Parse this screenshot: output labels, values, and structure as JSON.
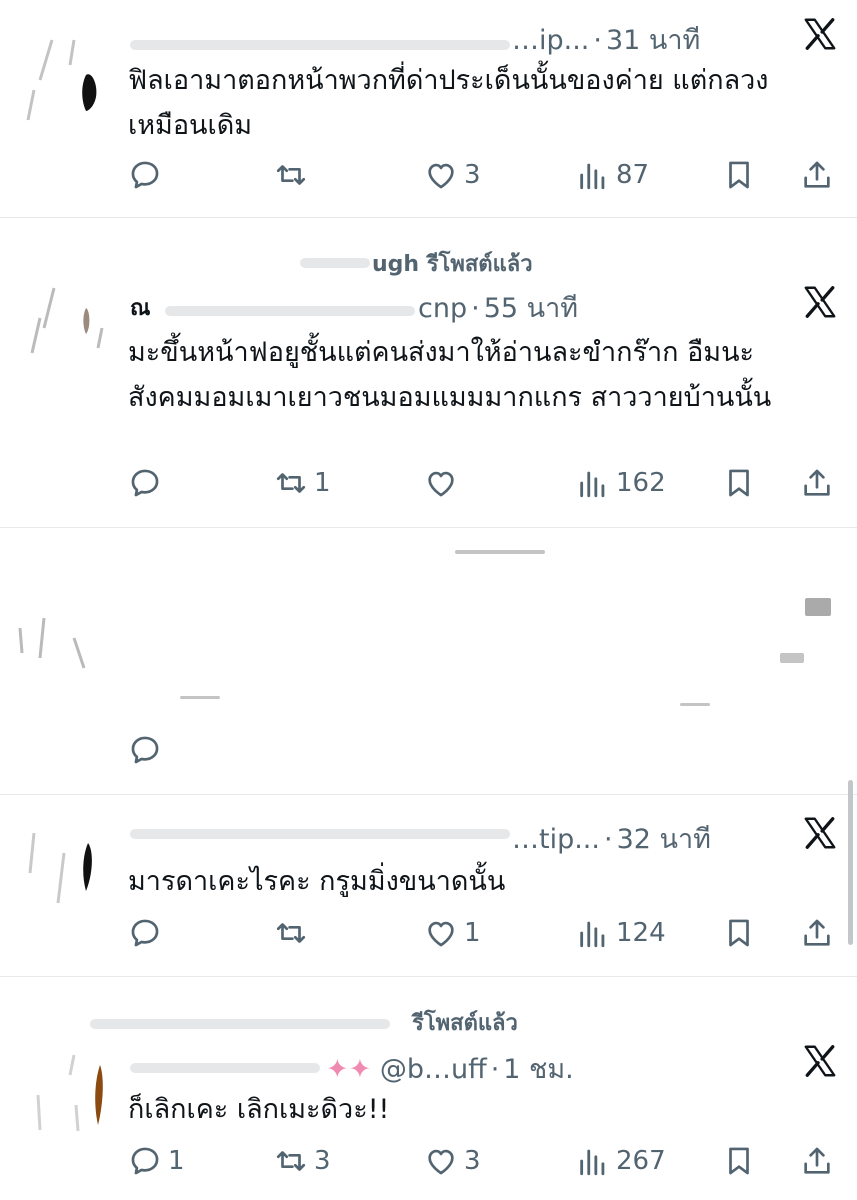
{
  "posts": [
    {
      "repost_label": "",
      "name_initial": "",
      "handle": "…ip...",
      "separator": "·",
      "time": "31 นาที",
      "text": "ฟิลเอามาตอกหน้าพวกที่ด่าประเด็นนั้นของค่าย แต่กลวงเหมือนเดิม",
      "counts": {
        "reply": "",
        "repost": "",
        "like": "3",
        "views": "87"
      }
    },
    {
      "repost_label": "ugh รีโพสต์แล้ว",
      "name_initial": "ณ",
      "handle": "cnp",
      "separator": "·",
      "time": "55 นาที",
      "text": "มะขึ้นหน้าฟอยูชั้นแต่คนส่งมาให้อ่านละขำกร๊าก อืมนะ สังคมมอมเมาเยาวชนมอมแมมมากแกร สาววายบ้านนั้น",
      "counts": {
        "reply": "",
        "repost": "1",
        "like": "",
        "views": "162"
      }
    },
    {
      "repost_label": "",
      "name_initial": "",
      "handle": "",
      "separator": "",
      "time": "",
      "text": "",
      "counts": {
        "reply": "",
        "repost": "",
        "like": "",
        "views": ""
      }
    },
    {
      "repost_label": "",
      "name_initial": "",
      "handle": "…tip...",
      "separator": "·",
      "time": "32 นาที",
      "text": "มารดาเคะไรคะ กรูมมิ่งขนาดนั้น",
      "counts": {
        "reply": "",
        "repost": "",
        "like": "1",
        "views": "124"
      }
    },
    {
      "repost_label": "รีโพสต์แล้ว",
      "name_initial": "",
      "handle": "@b…uff",
      "separator": "·",
      "time": "1 ชม.",
      "text": "ก็เลิกเคะ เลิกเมะดิวะ!!",
      "counts": {
        "reply": "1",
        "repost": "3",
        "like": "3",
        "views": "267"
      }
    }
  ],
  "icons": {
    "reply": "reply-icon",
    "repost": "repost-icon",
    "like": "heart-icon",
    "views": "views-icon",
    "bookmark": "bookmark-icon",
    "share": "share-icon",
    "brand": "x-logo-icon"
  },
  "colors": {
    "text": "#0f1419",
    "muted": "#536471",
    "divider": "#e6e9ec"
  }
}
